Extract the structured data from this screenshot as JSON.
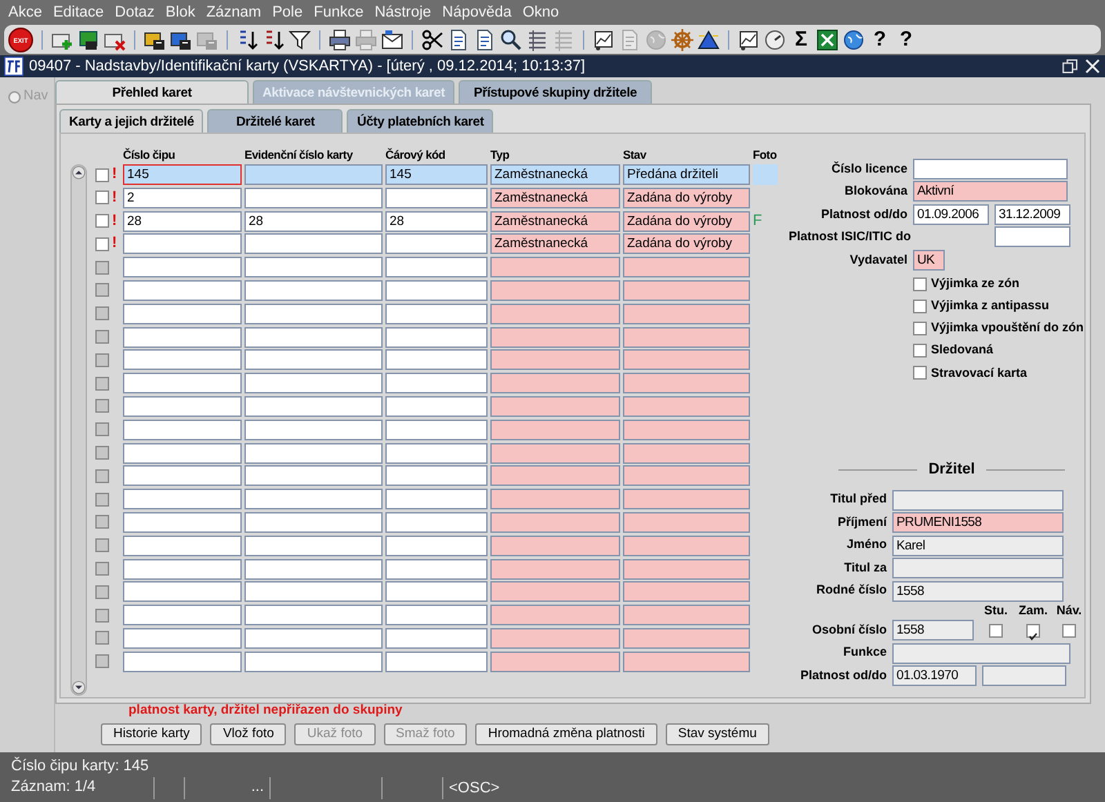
{
  "menu": [
    "Akce",
    "Editace",
    "Dotaz",
    "Blok",
    "Záznam",
    "Pole",
    "Funkce",
    "Nástroje",
    "Nápověda",
    "Okno"
  ],
  "toolbar": [
    {
      "kind": "exit",
      "text": "EXIT",
      "disabled": false
    },
    {
      "kind": "separator"
    },
    {
      "kind": "card-add",
      "disabled": false
    },
    {
      "kind": "card-save",
      "disabled": false
    },
    {
      "kind": "card-delete",
      "disabled": false
    },
    {
      "kind": "separator"
    },
    {
      "kind": "query",
      "color": "#e0b020",
      "disabled": false
    },
    {
      "kind": "query",
      "color": "#2a6ad0",
      "disabled": false
    },
    {
      "kind": "query",
      "color": "#909090",
      "disabled": true
    },
    {
      "kind": "separator"
    },
    {
      "kind": "sort-asc",
      "disabled": false
    },
    {
      "kind": "sort-desc",
      "disabled": false
    },
    {
      "kind": "filter",
      "disabled": false
    },
    {
      "kind": "separator"
    },
    {
      "kind": "print",
      "disabled": false
    },
    {
      "kind": "print",
      "disabled": true
    },
    {
      "kind": "mail",
      "disabled": false
    },
    {
      "kind": "separator"
    },
    {
      "kind": "cut",
      "disabled": false
    },
    {
      "kind": "document",
      "disabled": false
    },
    {
      "kind": "document",
      "disabled": false
    },
    {
      "kind": "search",
      "disabled": false
    },
    {
      "kind": "list",
      "disabled": false
    },
    {
      "kind": "list",
      "disabled": true
    },
    {
      "kind": "separator"
    },
    {
      "kind": "chart",
      "disabled": false
    },
    {
      "kind": "document",
      "disabled": true
    },
    {
      "kind": "globe",
      "disabled": true
    },
    {
      "kind": "wheel",
      "disabled": false
    },
    {
      "kind": "triangle",
      "disabled": false
    },
    {
      "kind": "separator"
    },
    {
      "kind": "chart",
      "disabled": false
    },
    {
      "kind": "gauge",
      "disabled": false
    },
    {
      "kind": "glyph",
      "text": "Σ",
      "disabled": false
    },
    {
      "kind": "spreadsheet",
      "disabled": false
    },
    {
      "kind": "globe",
      "disabled": false
    },
    {
      "kind": "glyph",
      "text": "?",
      "disabled": false
    },
    {
      "kind": "glyph",
      "text": "?",
      "disabled": false
    }
  ],
  "window": {
    "title": "09407 - Nadstavby/Identifikační karty (VSKARTYA) - [úterý  , 09.12.2014; 10:13:37]"
  },
  "nav": {
    "label": "Nav",
    "checked": false,
    "disabled": true
  },
  "tabs": [
    {
      "label": "Přehled karet",
      "selected": true,
      "disabled": false
    },
    {
      "label": "Aktivace návštevnických karet",
      "selected": false,
      "disabled": true
    },
    {
      "label": "Přístupové skupiny držitele",
      "selected": false,
      "disabled": false
    }
  ],
  "subtabs": [
    {
      "label": "Karty a jejich držitelé",
      "selected": true
    },
    {
      "label": "Držitelé karet",
      "selected": false
    },
    {
      "label": "Účty platebních karet",
      "selected": false
    }
  ],
  "table": {
    "columns": [
      "Číslo čipu",
      "Evidenční číslo karty",
      "Čárový kód",
      "Typ",
      "Stav",
      "Foto"
    ],
    "rows": [
      {
        "selected": true,
        "focused": true,
        "checked": false,
        "disabled": false,
        "flag": "!",
        "chip": "145",
        "barcode": "145",
        "type": "Zaměstnanecká",
        "state": "Předána držiteli"
      },
      {
        "selected": false,
        "focused": false,
        "checked": false,
        "disabled": false,
        "flag": "!",
        "chip": "2",
        "type": "Zaměstnanecká",
        "state": "Zadána do výroby"
      },
      {
        "selected": false,
        "focused": false,
        "checked": false,
        "disabled": false,
        "flag": "!",
        "chip": "28",
        "evidence": "28",
        "barcode": "28",
        "type": "Zaměstnanecká",
        "state": "Zadána do výroby",
        "photo": "F"
      },
      {
        "selected": false,
        "focused": false,
        "checked": false,
        "disabled": false,
        "flag": "!",
        "type": "Zaměstnanecká",
        "state": "Zadána do výroby"
      },
      {
        "selected": false,
        "focused": false,
        "checked": false,
        "disabled": true
      },
      {
        "selected": false,
        "focused": false,
        "checked": false,
        "disabled": true
      },
      {
        "selected": false,
        "focused": false,
        "checked": false,
        "disabled": true
      },
      {
        "selected": false,
        "focused": false,
        "checked": false,
        "disabled": true
      },
      {
        "selected": false,
        "focused": false,
        "checked": false,
        "disabled": true
      },
      {
        "selected": false,
        "focused": false,
        "checked": false,
        "disabled": true
      },
      {
        "selected": false,
        "focused": false,
        "checked": false,
        "disabled": true
      },
      {
        "selected": false,
        "focused": false,
        "checked": false,
        "disabled": true
      },
      {
        "selected": false,
        "focused": false,
        "checked": false,
        "disabled": true
      },
      {
        "selected": false,
        "focused": false,
        "checked": false,
        "disabled": true
      },
      {
        "selected": false,
        "focused": false,
        "checked": false,
        "disabled": true
      },
      {
        "selected": false,
        "focused": false,
        "checked": false,
        "disabled": true
      },
      {
        "selected": false,
        "focused": false,
        "checked": false,
        "disabled": true
      },
      {
        "selected": false,
        "focused": false,
        "checked": false,
        "disabled": true
      },
      {
        "selected": false,
        "focused": false,
        "checked": false,
        "disabled": true
      },
      {
        "selected": false,
        "focused": false,
        "checked": false,
        "disabled": true
      },
      {
        "selected": false,
        "focused": false,
        "checked": false,
        "disabled": true
      },
      {
        "selected": false,
        "focused": false,
        "checked": false,
        "disabled": true
      }
    ],
    "message": "platnost karty, držitel nepřiřazen do skupiny"
  },
  "card_form": {
    "readonly": false,
    "fields": [
      {
        "kind": "single",
        "label": "Číslo licence",
        "required": false
      },
      {
        "kind": "single",
        "label": "Blokována",
        "required": true,
        "inputs": [
          {
            "value": "Aktivní"
          }
        ]
      },
      {
        "kind": "range",
        "label": "Platnost od/do",
        "required": false,
        "inputs": [
          {
            "value": "01.09.2006"
          },
          {
            "value": "31.12.2009"
          }
        ]
      },
      {
        "kind": "end",
        "label": "Platnost ISIC/ITIC do",
        "required": false
      },
      {
        "kind": "short",
        "label": "Vydavatel",
        "required": true,
        "inputs": [
          {
            "value": "UK"
          }
        ]
      }
    ],
    "checks": [
      {
        "label": "Výjimka ze zón",
        "checked": false
      },
      {
        "label": "Výjimka z antipassu",
        "checked": false
      },
      {
        "label": "Výjimka vpouštění do zón",
        "checked": false
      },
      {
        "label": "Sledovaná",
        "checked": false
      },
      {
        "label": "Stravovací karta",
        "checked": false
      }
    ]
  },
  "holder": {
    "title": "Držitel",
    "readonly": true,
    "fields": [
      {
        "kind": "single",
        "label": "Titul před",
        "required": false
      },
      {
        "kind": "single",
        "label": "Příjmení",
        "required": true,
        "inputs": [
          {
            "value": "PRUMENI1558"
          }
        ]
      },
      {
        "kind": "single",
        "label": "Jméno",
        "required": false,
        "inputs": [
          {
            "value": "Karel"
          }
        ]
      },
      {
        "kind": "single",
        "label": "Titul za",
        "required": false
      },
      {
        "kind": "single",
        "label": "Rodné číslo",
        "required": false,
        "inputs": [
          {
            "value": "1558"
          }
        ]
      },
      {
        "kind": "types",
        "label": "Osobní číslo",
        "required": false,
        "inputs": [
          {
            "value": "1558"
          }
        ]
      },
      {
        "kind": "wide",
        "label": "Funkce",
        "required": false
      },
      {
        "kind": "range",
        "label": "Platnost od/do",
        "required": false,
        "inputs": [
          {
            "value": "01.03.1970"
          }
        ]
      }
    ],
    "types": [
      {
        "label": "Stu.",
        "checked": false
      },
      {
        "label": "Zam.",
        "checked": true
      },
      {
        "label": "Náv.",
        "checked": false
      }
    ]
  },
  "buttons": [
    {
      "label": "Historie karty",
      "disabled": false
    },
    {
      "label": "Vlož foto",
      "disabled": false
    },
    {
      "label": "Ukaž foto",
      "disabled": true
    },
    {
      "label": "Smaž foto",
      "disabled": true
    },
    {
      "label": "Hromadná změna platnosti",
      "disabled": false
    },
    {
      "label": "Stav systému",
      "disabled": false
    }
  ],
  "status": {
    "message": "Číslo čipu karty: 145",
    "record": "Záznam: 1/4",
    "block": "...",
    "mode": "<OSC>"
  }
}
